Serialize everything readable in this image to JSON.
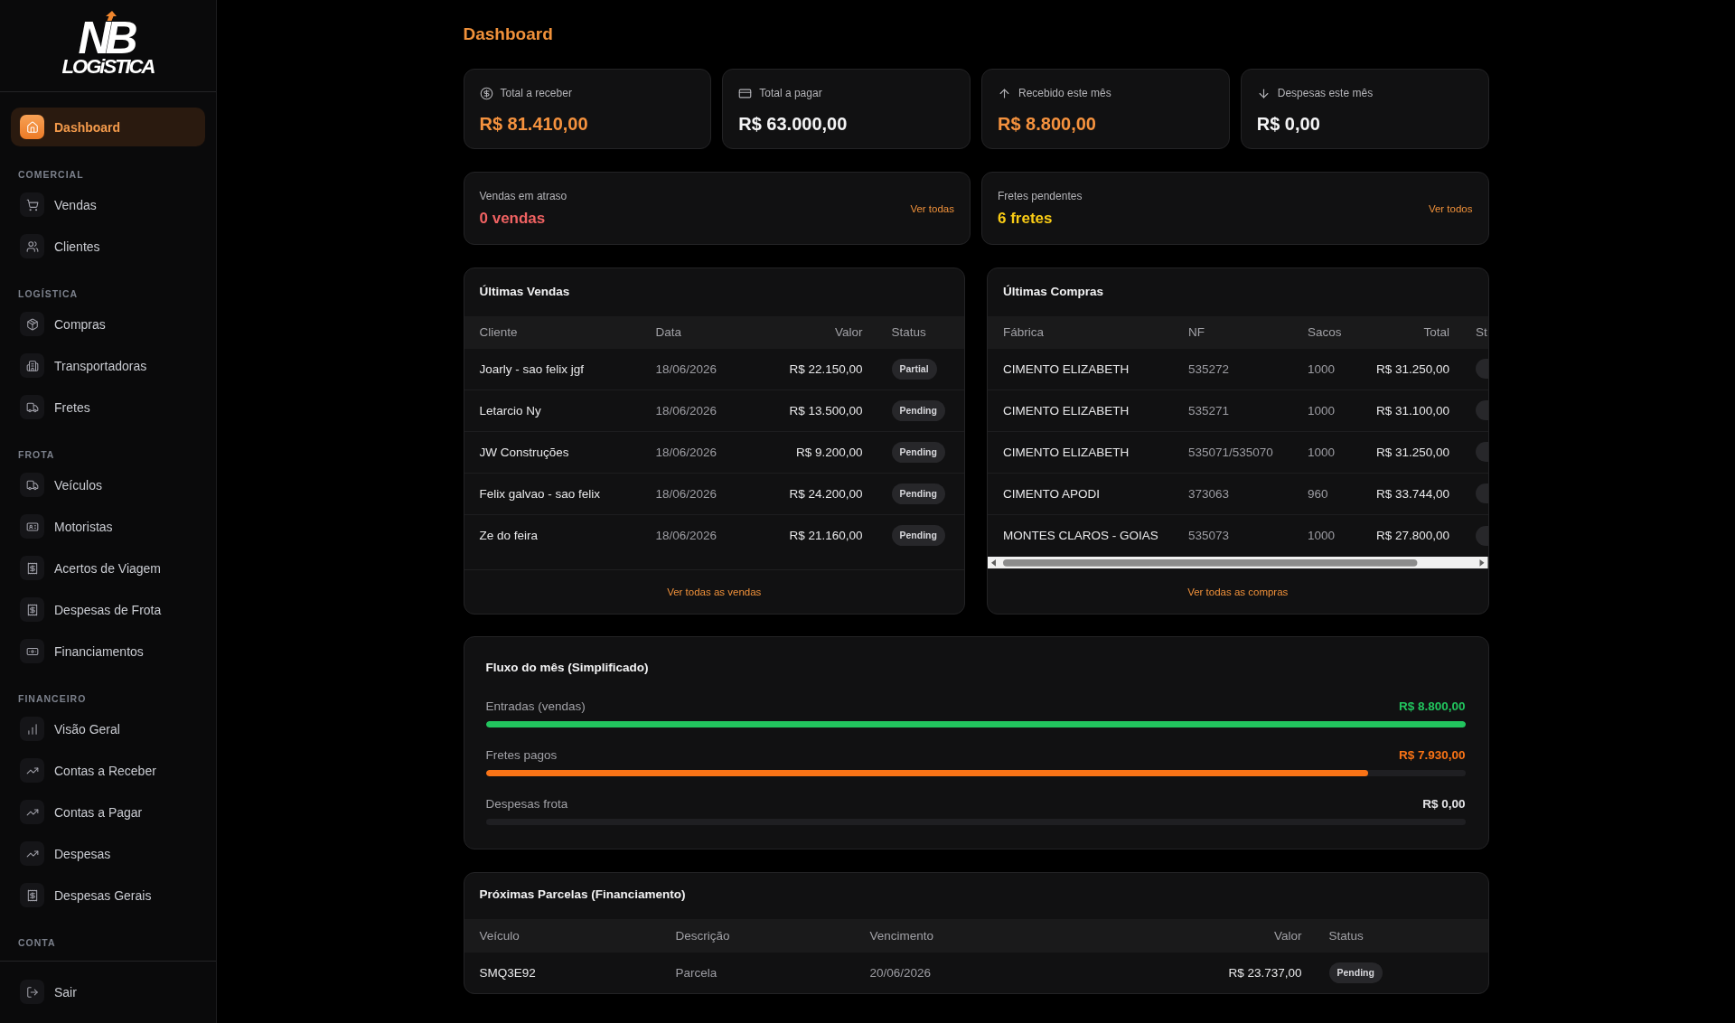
{
  "sidebar": {
    "logo": {
      "monogram": "NB",
      "wordmark": "LOGiSTICA"
    },
    "sections": [
      {
        "items": [
          {
            "label": "Dashboard",
            "selected": true
          }
        ]
      },
      {
        "title": "COMERCIAL",
        "items": [
          {
            "label": "Vendas",
            "selected": false
          },
          {
            "label": "Clientes",
            "selected": false
          }
        ]
      },
      {
        "title": "LOGÍSTICA",
        "items": [
          {
            "label": "Compras",
            "selected": false
          },
          {
            "label": "Transportadoras",
            "selected": false
          },
          {
            "label": "Fretes",
            "selected": false
          }
        ]
      },
      {
        "title": "FROTA",
        "items": [
          {
            "label": "Veículos",
            "selected": false
          },
          {
            "label": "Motoristas",
            "selected": false
          },
          {
            "label": "Acertos de Viagem",
            "selected": false
          },
          {
            "label": "Despesas de Frota",
            "selected": false
          },
          {
            "label": "Financiamentos",
            "selected": false
          }
        ]
      },
      {
        "title": "FINANCEIRO",
        "items": [
          {
            "label": "Visão Geral",
            "selected": false
          },
          {
            "label": "Contas a Receber",
            "selected": false
          },
          {
            "label": "Contas a Pagar",
            "selected": false
          },
          {
            "label": "Despesas",
            "selected": false
          },
          {
            "label": "Despesas Gerais",
            "selected": false
          }
        ]
      },
      {
        "title": "CONTA"
      }
    ],
    "footer_item": {
      "label": "Sair"
    }
  },
  "page": {
    "title": "Dashboard"
  },
  "stats": [
    {
      "label": "Total a receber",
      "value": "R$ 81.410,00",
      "color": "#f5923e"
    },
    {
      "label": "Total a pagar",
      "value": "R$ 63.000,00",
      "color": "#f4f4f5"
    },
    {
      "label": "Recebido este mês",
      "value": "R$ 8.800,00",
      "color": "#f5923e"
    },
    {
      "label": "Despesas este mês",
      "value": "R$ 0,00",
      "color": "#f4f4f5"
    }
  ],
  "alerts": [
    {
      "label": "Vendas em atraso",
      "value": "0 vendas",
      "color": "#f06262",
      "link": "Ver todas"
    },
    {
      "label": "Fretes pendentes",
      "value": "6 fretes",
      "color": "#facc15",
      "link": "Ver todos"
    }
  ],
  "recent_sales": {
    "title": "Últimas Vendas",
    "columns": [
      "Cliente",
      "Data",
      "Valor",
      "Status"
    ],
    "rows": [
      [
        "Joarly - sao felix jgf",
        "18/06/2026",
        "R$ 22.150,00",
        "Partial"
      ],
      [
        "Letarcio Ny",
        "18/06/2026",
        "R$ 13.500,00",
        "Pending"
      ],
      [
        "JW Construções",
        "18/06/2026",
        "R$ 9.200,00",
        "Pending"
      ],
      [
        "Felix galvao - sao felix",
        "18/06/2026",
        "R$ 24.200,00",
        "Pending"
      ],
      [
        "Ze do feira",
        "18/06/2026",
        "R$ 21.160,00",
        "Pending"
      ]
    ],
    "footer_link": "Ver todas as vendas"
  },
  "recent_purchases": {
    "title": "Últimas Compras",
    "columns": [
      "Fábrica",
      "NF",
      "Sacos",
      "Total",
      "St"
    ],
    "rows": [
      [
        "CIMENTO ELIZABETH",
        "535272",
        "1000",
        "R$ 31.250,00"
      ],
      [
        "CIMENTO ELIZABETH",
        "535271",
        "1000",
        "R$ 31.100,00"
      ],
      [
        "CIMENTO ELIZABETH",
        "535071/535070",
        "1000",
        "R$ 31.250,00"
      ],
      [
        "CIMENTO APODI",
        "373063",
        "960",
        "R$ 33.744,00"
      ],
      [
        "MONTES CLAROS - GOIAS",
        "535073",
        "1000",
        "R$ 27.800,00"
      ]
    ],
    "footer_link": "Ver todas as compras"
  },
  "flow": {
    "title": "Fluxo do mês (Simplificado)",
    "rows": [
      {
        "label": "Entradas (vendas)",
        "value": "R$ 8.800,00",
        "color": "#22c55e",
        "level": 1
      },
      {
        "label": "Fretes pagos",
        "value": "R$ 7.930,00",
        "color": "#f97316",
        "level": 0.901
      },
      {
        "label": "Despesas frota",
        "value": "R$ 0,00",
        "color": "#e4e4e7"
      }
    ]
  },
  "installments": {
    "title": "Próximas Parcelas (Financiamento)",
    "columns": [
      "Veículo",
      "Descrição",
      "Vencimento",
      "Valor",
      "Status"
    ],
    "rows": [
      [
        "SMQ3E92",
        "Parcela",
        "20/06/2026",
        "R$ 23.737,00",
        "Pending"
      ]
    ]
  }
}
